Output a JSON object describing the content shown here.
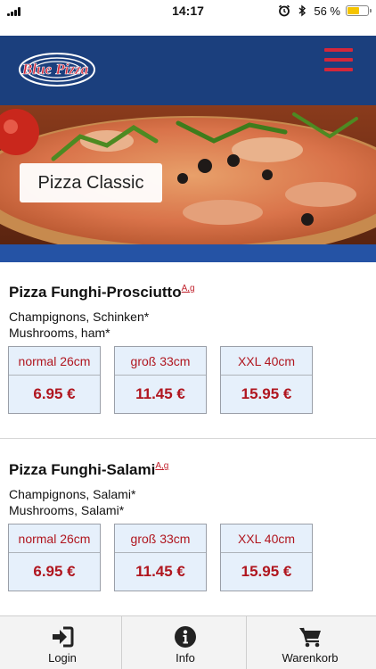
{
  "status_bar": {
    "time": "14:17",
    "battery_text": "56 %",
    "battery_level": 0.56,
    "battery_color": "#f5c400"
  },
  "header": {
    "logo_text": "Blue Pizza",
    "logo_icon": "blue-pizza-logo",
    "menu_icon": "hamburger-menu-icon",
    "background": "#1b3f7d",
    "menu_color": "#d4273a"
  },
  "hero": {
    "category_label": "Pizza Classic"
  },
  "products": [
    {
      "name": "Pizza Funghi-Prosciutto",
      "allergens": "A,g",
      "desc_de": "Champignons, Schinken*",
      "desc_en": "Mushrooms, ham*",
      "options": [
        {
          "size": "normal 26cm",
          "price": "6.95 €"
        },
        {
          "size": "groß 33cm",
          "price": "11.45 €"
        },
        {
          "size": "XXL 40cm",
          "price": "15.95 €"
        }
      ]
    },
    {
      "name": "Pizza Funghi-Salami",
      "allergens": "A,g",
      "desc_de": "Champignons, Salami*",
      "desc_en": "Mushrooms, Salami*",
      "options": [
        {
          "size": "normal 26cm",
          "price": "6.95 €"
        },
        {
          "size": "groß 33cm",
          "price": "11.45 €"
        },
        {
          "size": "XXL 40cm",
          "price": "15.95 €"
        }
      ]
    }
  ],
  "tabs": [
    {
      "label": "Login",
      "icon": "login-icon"
    },
    {
      "label": "Info",
      "icon": "info-icon"
    },
    {
      "label": "Warenkorb",
      "icon": "cart-icon"
    }
  ],
  "colors": {
    "accent_red": "#b0161f",
    "price_box_bg": "#e6f0fb",
    "blue_bar": "#2553a5"
  }
}
